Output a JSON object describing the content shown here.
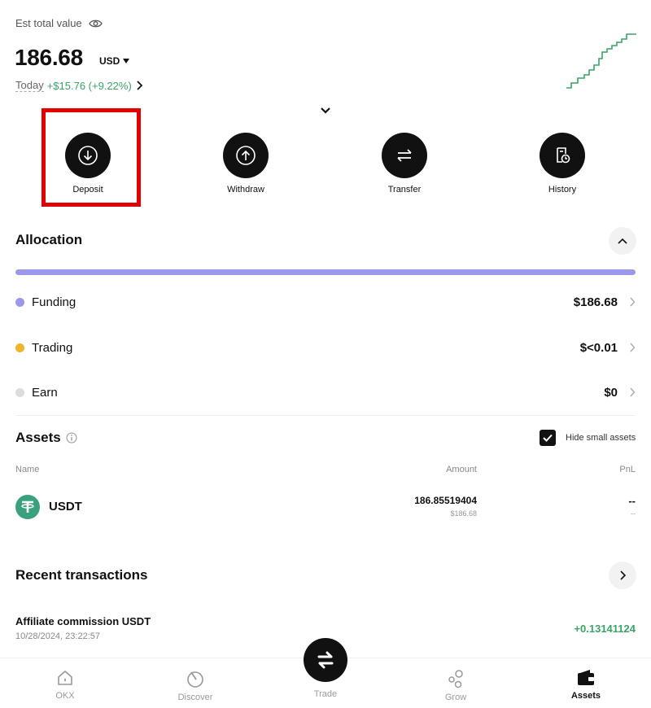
{
  "header": {
    "est_label": "Est total value",
    "total_value": "186.68",
    "currency": "USD",
    "today_label": "Today",
    "today_change": "+$15.76 (+9.22%)"
  },
  "actions": [
    {
      "label": "Deposit",
      "icon": "download-icon"
    },
    {
      "label": "Withdraw",
      "icon": "upload-icon"
    },
    {
      "label": "Transfer",
      "icon": "transfer-icon"
    },
    {
      "label": "History",
      "icon": "history-icon"
    }
  ],
  "allocation": {
    "title": "Allocation",
    "items": [
      {
        "name": "Funding",
        "value": "$186.68",
        "color": "#9b97ec"
      },
      {
        "name": "Trading",
        "value": "$<0.01",
        "color": "#f0b429"
      },
      {
        "name": "Earn",
        "value": "$0",
        "color": "#dddddd"
      }
    ]
  },
  "assets": {
    "title": "Assets",
    "hide_small_label": "Hide small assets",
    "hide_small_checked": true,
    "columns": {
      "name": "Name",
      "amount": "Amount",
      "pnl": "PnL"
    },
    "rows": [
      {
        "name": "USDT",
        "amount": "186.85519404",
        "amount_usd": "$186.68",
        "pnl": "--",
        "pnl_sub": "--"
      }
    ]
  },
  "transactions": {
    "title": "Recent transactions",
    "items": [
      {
        "title": "Affiliate commission USDT",
        "time": "10/28/2024, 23:22:57",
        "amount": "+0.13141124"
      }
    ]
  },
  "nav": [
    {
      "label": "OKX",
      "icon": "home-icon",
      "active": false
    },
    {
      "label": "Discover",
      "icon": "discover-icon",
      "active": false
    },
    {
      "label": "Trade",
      "icon": "trade-icon",
      "active": false
    },
    {
      "label": "Grow",
      "icon": "grow-icon",
      "active": false
    },
    {
      "label": "Assets",
      "icon": "wallet-icon",
      "active": true
    }
  ],
  "colors": {
    "accent_green": "#3aa368",
    "highlight_red": "#e50000",
    "allocation_bar": "#9b97ec"
  }
}
